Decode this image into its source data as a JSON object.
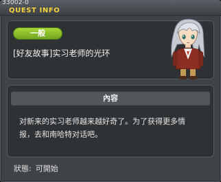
{
  "window": {
    "quest_id": "33002-0",
    "title": "QUEST INFO"
  },
  "quest": {
    "category_badge": "一般",
    "name": "[好友故事]实习老师的光环",
    "npc_icon": "npc-portrait-silver-haired-girl"
  },
  "content": {
    "header": "內容",
    "description_line1": "对新来的实习老师越来越好奇了。为了获得更多情",
    "description_line2": "报，去和南哈特对话吧。"
  },
  "status": {
    "label": "狀態:",
    "value": "可開始"
  },
  "colors": {
    "title_yellow": "#f5d23a",
    "badge_green": "#8cc63f",
    "panel_bg": "#2f3235",
    "window_bg": "#3f4347"
  }
}
